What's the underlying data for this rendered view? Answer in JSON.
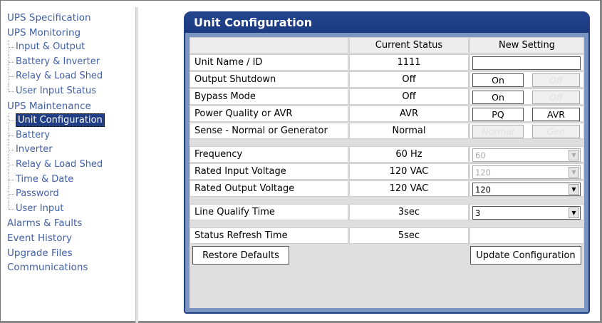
{
  "nav": {
    "items": [
      {
        "label": "UPS Specification",
        "level": 0
      },
      {
        "label": "UPS Monitoring",
        "level": 0
      },
      {
        "label": "Input & Output",
        "level": 1
      },
      {
        "label": "Battery & Inverter",
        "level": 1
      },
      {
        "label": "Relay & Load Shed",
        "level": 1
      },
      {
        "label": "User Input Status",
        "level": 1,
        "last": true
      },
      {
        "label": "UPS Maintenance",
        "level": 0
      },
      {
        "label": "Unit Configuration",
        "level": 1,
        "selected": true
      },
      {
        "label": "Battery",
        "level": 1
      },
      {
        "label": "Inverter",
        "level": 1
      },
      {
        "label": "Relay & Load Shed",
        "level": 1
      },
      {
        "label": "Time & Date",
        "level": 1
      },
      {
        "label": "Password",
        "level": 1
      },
      {
        "label": "User Input",
        "level": 1,
        "last": true
      },
      {
        "label": "Alarms & Faults",
        "level": 0
      },
      {
        "label": "Event History",
        "level": 0
      },
      {
        "label": "Upgrade Files",
        "level": 0
      },
      {
        "label": "Communications",
        "level": 0
      }
    ]
  },
  "panel": {
    "title": "Unit Configuration",
    "headers": {
      "current": "Current Status",
      "new": "New Setting"
    },
    "rows": {
      "unit_name": {
        "label": "Unit Name / ID",
        "current": "1111",
        "input_value": ""
      },
      "output_shutdown": {
        "label": "Output Shutdown",
        "current": "Off",
        "on": "On",
        "off": "Off"
      },
      "bypass_mode": {
        "label": "Bypass Mode",
        "current": "Off",
        "on": "On",
        "off": "Off"
      },
      "power_quality": {
        "label": "Power Quality or AVR",
        "current": "AVR",
        "opt1": "PQ",
        "opt2": "AVR"
      },
      "sense": {
        "label": "Sense - Normal or Generator",
        "current": "Normal",
        "opt1": "Normal",
        "opt2": "Gen"
      },
      "frequency": {
        "label": "Frequency",
        "current": "60 Hz",
        "select": "60"
      },
      "rated_input": {
        "label": "Rated Input Voltage",
        "current": "120 VAC",
        "select": "120"
      },
      "rated_output": {
        "label": "Rated Output Voltage",
        "current": "120 VAC",
        "select": "120"
      },
      "line_qualify": {
        "label": "Line Qualify Time",
        "current": "3sec",
        "select": "3"
      },
      "status_refresh": {
        "label": "Status Refresh Time",
        "current": "5sec"
      }
    },
    "buttons": {
      "restore": "Restore Defaults",
      "update": "Update Configuration"
    }
  },
  "colors": {
    "panel_header": "#1f3e85",
    "nav_link": "#4160a8",
    "panel_border": "#7a96c0"
  },
  "icons": {
    "dropdown": "chevron-down-icon"
  }
}
